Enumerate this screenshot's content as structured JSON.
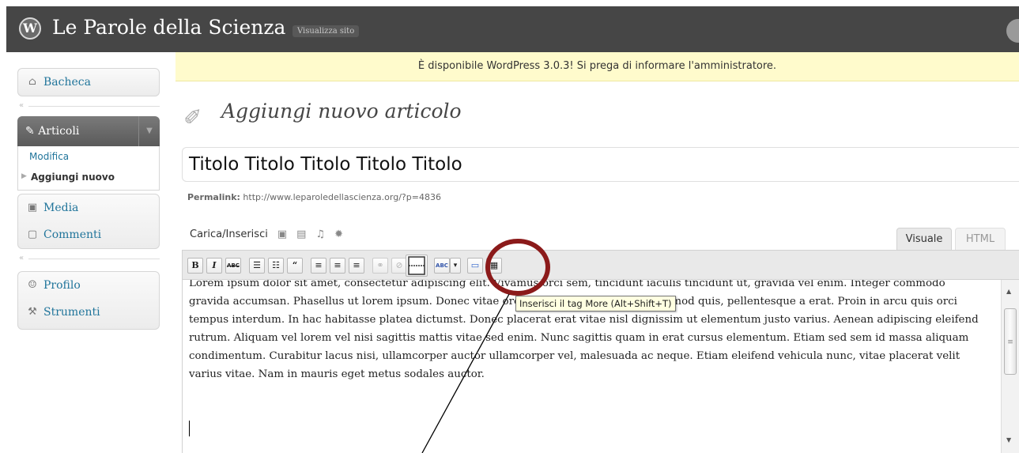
{
  "header": {
    "logo_letter": "W",
    "site_title": "Le Parole della Scienza",
    "view_site": "Visualizza sito"
  },
  "notice": "È disponibile WordPress 3.0.3! Si prega di informare l'amministratore.",
  "sidebar": {
    "bacheca": "Bacheca",
    "articoli": "Articoli",
    "articoli_sub": [
      "Modifica",
      "Aggiungi nuovo"
    ],
    "media": "Media",
    "commenti": "Commenti",
    "profilo": "Profilo",
    "strumenti": "Strumenti"
  },
  "page": {
    "title": "Aggiungi nuovo articolo",
    "post_title_value": "Titolo Titolo Titolo Titolo Titolo",
    "permalink_label": "Permalink:",
    "permalink_url": "http://www.leparoledellascienza.org/?p=4836",
    "upload_label": "Carica/Inserisci"
  },
  "editor": {
    "tab_visual": "Visuale",
    "tab_html": "HTML",
    "toolbar": [
      "B",
      "I",
      "ABC",
      "☰",
      "☷",
      "“",
      "≡",
      "≡",
      "≡",
      "⚭",
      "⊘",
      "More",
      "ABC",
      "▾",
      "▭",
      "▦"
    ],
    "tooltip": "Inserisci il tag More (Alt+Shift+T)",
    "content": "Lorem ipsum dolor sit amet, consectetur adipiscing elit. Vivamus orci sem, tincidunt iaculis tincidunt ut, gravida vel enim. Integer commodo gravida accumsan. Phasellus ut lorem ipsum. Donec vitae orci elit, pellentesque eget euismod quis, pellentesque a erat. Proin in arcu quis orci tempus interdum. In hac habitasse platea dictumst. Donec placerat erat vitae nisl dignissim ut elementum justo varius. Aenean adipiscing eleifend rutrum. Aliquam vel lorem vel nisi sagittis mattis vitae sed enim. Nunc sagittis quam in erat cursus elementum. Etiam sed sem id massa aliquam condimentum. Curabitur lacus nisi, ullamcorper auctor ullamcorper vel, malesuada ac neque. Etiam eleifend vehicula nunc, vitae placerat velit varius vitae. Nam in mauris eget metus sodales auctor."
  },
  "colors": {
    "header_bg": "#464646",
    "notice_bg": "#fffbcc",
    "link": "#21759b",
    "annotation": "#8b1a1a"
  }
}
